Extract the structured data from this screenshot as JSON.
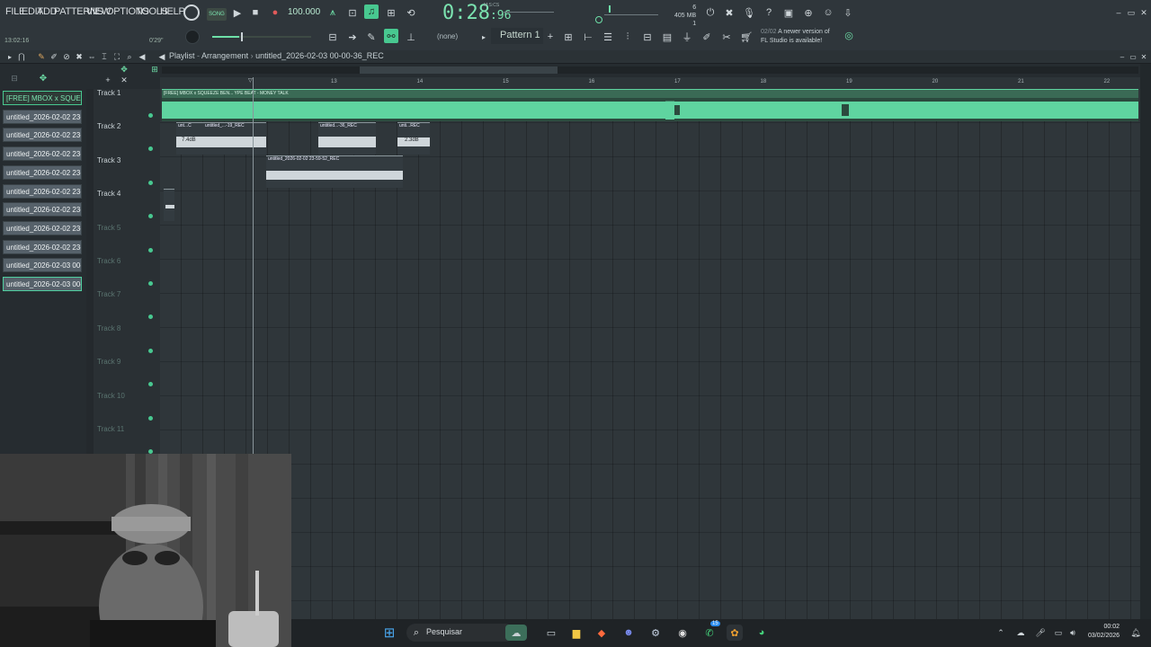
{
  "menu": [
    "FILE",
    "EDIT",
    "ADD",
    "PATTERNS",
    "VIEW",
    "OPTIONS",
    "TOOLS",
    "HELP"
  ],
  "transport": {
    "song_mode": "SONG",
    "tempo": "100.000",
    "time_main": "0:28",
    "time_frac": ":96",
    "time_label": "M:S:CS",
    "cursor_time": "13:02:16",
    "song_pos": "0'29\"",
    "pattern": "Pattern 1",
    "channel_none": "(none)",
    "mem_top": "6",
    "mem": "405 MB",
    "mem_bottom": "1",
    "update_line1_date": "02/02",
    "update_line1": "A newer version of",
    "update_line2": "FL Studio is available!"
  },
  "playlist": {
    "title": "Playlist",
    "mode": "Arrangement",
    "file": "untitled_2026-02-03 00-00-36_REC",
    "ruler": [
      "13",
      "14",
      "15",
      "16",
      "17",
      "18",
      "19",
      "20",
      "21",
      "22",
      "23"
    ],
    "tracks": [
      {
        "name": "Track 1",
        "empty": false
      },
      {
        "name": "Track 2",
        "empty": false
      },
      {
        "name": "Track 3",
        "empty": false
      },
      {
        "name": "Track 4",
        "empty": false
      },
      {
        "name": "Track 5",
        "empty": true
      },
      {
        "name": "Track 6",
        "empty": true
      },
      {
        "name": "Track 7",
        "empty": true
      },
      {
        "name": "Track 8",
        "empty": true
      },
      {
        "name": "Track 9",
        "empty": true
      },
      {
        "name": "Track 10",
        "empty": true
      },
      {
        "name": "Track 11",
        "empty": true
      }
    ],
    "clip_list": [
      "[FREE] MBOX x SQUE...",
      "untitled_2026-02-02 23-...",
      "untitled_2026-02-02 23-...",
      "untitled_2026-02-02 23-...",
      "untitled_2026-02-02 23-...",
      "untitled_2026-02-02 23-...",
      "untitled_2026-02-02 23-...",
      "untitled_2026-02-02 23-...",
      "untitled_2026-02-02 23-...",
      "untitled_2026-02-03 00-...",
      "untitled_2026-02-03 00-..."
    ],
    "clips": {
      "beat": "[FREE] MBOX x SQUEEZE BEN... YPE BEAT - MONEY TALK",
      "t2a": "unt...C",
      "t2b": "untitled_...-19_REC",
      "t2c": "untitled...-36_REC",
      "t2d": "unti...REC",
      "t2a_vol": "7.4dB",
      "t2d_vol": "2.3dB",
      "t3": "untitled_2026-02-02 23-59-52_REC"
    }
  },
  "taskbar": {
    "search": "Pesquisar",
    "time": "00:02",
    "date": "03/02/2026",
    "badge_whatsapp": "15"
  },
  "colors": {
    "accent": "#48c890",
    "waveform": "#5fd4a0",
    "bg": "#24292d"
  }
}
